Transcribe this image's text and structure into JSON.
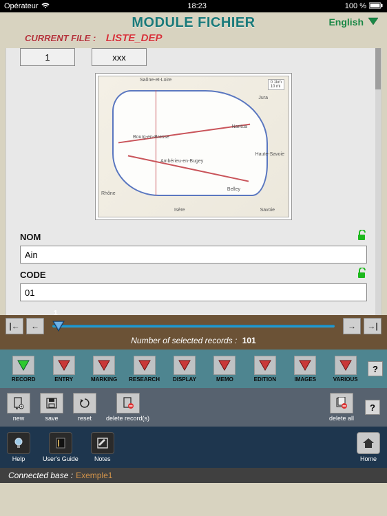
{
  "status": {
    "carrier": "Opérateur",
    "wifi": "wifi-icon",
    "time": "18:23",
    "battery_pct": "100 %"
  },
  "header": {
    "title": "MODULE FICHIER",
    "lang": "English",
    "current_file_label": "CURRENT FILE :",
    "current_file_value": "LISTE_DEP"
  },
  "top_boxes": {
    "box1": "1",
    "box2": "xxx"
  },
  "map": {
    "scale1": "0 1km",
    "scale2": "10 mi",
    "labels": [
      "Saône-et-Loire",
      "Jura",
      "Bourg-en-Bresse",
      "Haute-Savoie",
      "Rhône",
      "Isère",
      "Savoie",
      "Ambérieu-en-Bugey",
      "Nantua",
      "Belley"
    ]
  },
  "fields": {
    "nom": {
      "label": "NOM",
      "value": "Ain"
    },
    "code": {
      "label": "CODE",
      "value": "01"
    }
  },
  "slider": {
    "pos_label": "1",
    "records_label": "Number of selected records :",
    "records_count": "101",
    "nav": {
      "first": "|←",
      "prev": "←",
      "next": "→",
      "last": "→|"
    }
  },
  "tabs": {
    "items": [
      {
        "label": "RECORD",
        "active": true
      },
      {
        "label": "ENTRY"
      },
      {
        "label": "MARKING"
      },
      {
        "label": "RESEARCH"
      },
      {
        "label": "DISPLAY"
      },
      {
        "label": "MEMO"
      },
      {
        "label": "EDITION"
      },
      {
        "label": "IMAGES"
      },
      {
        "label": "VARIOUS"
      }
    ],
    "help": "?"
  },
  "actions": {
    "items": [
      {
        "label": "new"
      },
      {
        "label": "save"
      },
      {
        "label": "reset"
      },
      {
        "label": "delete record(s)"
      }
    ],
    "delete_all": "delete all",
    "help": "?"
  },
  "footer": {
    "items": [
      {
        "label": "Help"
      },
      {
        "label": "User's Guide"
      },
      {
        "label": "Notes"
      }
    ],
    "home": "Home"
  },
  "connected": {
    "label": "Connected base :",
    "value": "Exemple1"
  }
}
